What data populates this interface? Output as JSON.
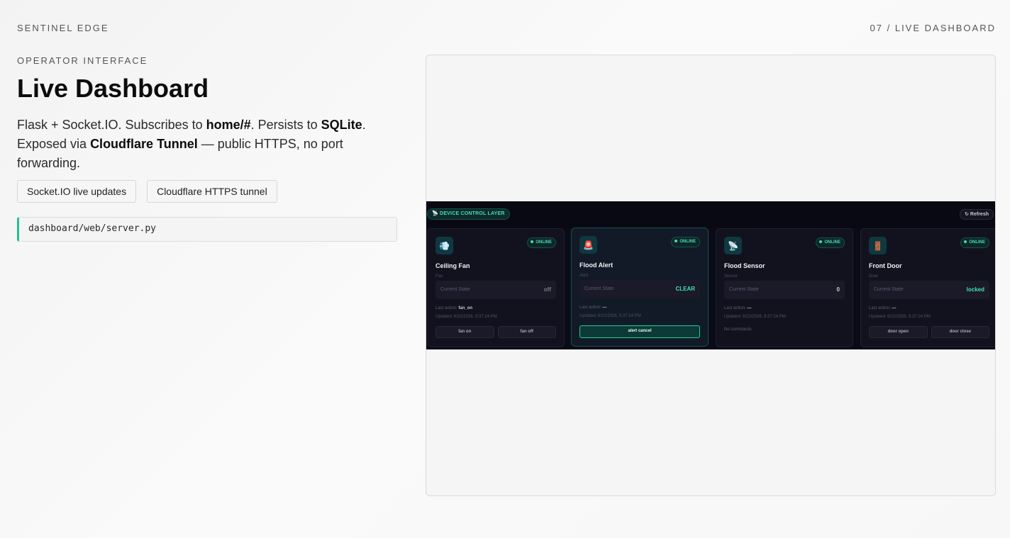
{
  "header": {
    "brand": "SENTINEL EDGE",
    "section": "07 / LIVE DASHBOARD"
  },
  "intro": {
    "eyebrow": "OPERATOR INTERFACE",
    "title": "Live Dashboard",
    "desc_part1": "Flask + Socket.IO. Subscribes to ",
    "desc_topic": "home/#",
    "desc_part2": ". Persists to ",
    "desc_db": "SQLite",
    "desc_part3": ". Exposed via ",
    "desc_tunnel": "Cloudflare Tunnel",
    "desc_part4": " — public HTTPS, no port forwarding.",
    "chips": [
      "Socket.IO live updates",
      "Cloudflare HTTPS tunnel"
    ],
    "code_path": "dashboard/web/server.py"
  },
  "screenshot": {
    "layer_label": "📡 DEVICE CONTROL LAYER",
    "refresh_label": "↻ Refresh",
    "online_label": "ONLINE",
    "state_label": "Current State",
    "last_action_label": "Last action:",
    "cards": [
      {
        "icon": "💨",
        "name": "Ceiling Fan",
        "type": "Fan",
        "value": "off",
        "last_action": "fan_on",
        "updated": "Updated: 6/22/2026, 9:37:24 PM",
        "buttons": [
          "fan on",
          "fan off"
        ]
      },
      {
        "icon": "🚨",
        "name": "Flood Alert",
        "type": "Alert",
        "value": "CLEAR",
        "last_action": "—",
        "updated": "Updated: 6/22/2026, 9:37:24 PM",
        "buttons": [
          "alert cancel"
        ]
      },
      {
        "icon": "📡",
        "name": "Flood Sensor",
        "type": "Sensor",
        "value": "0",
        "last_action": "—",
        "updated": "Updated: 6/22/2026, 9:37:24 PM",
        "no_commands": "No commands"
      },
      {
        "icon": "🚪",
        "name": "Front Door",
        "type": "Door",
        "value": "locked",
        "last_action": "—",
        "updated": "Updated: 6/22/2026, 9:37:24 PM",
        "buttons": [
          "door open",
          "door close"
        ]
      }
    ]
  },
  "colors": {
    "accent": "#21c58a",
    "online_green": "#3fe0b1",
    "dark_bg": "#0b0b18"
  }
}
